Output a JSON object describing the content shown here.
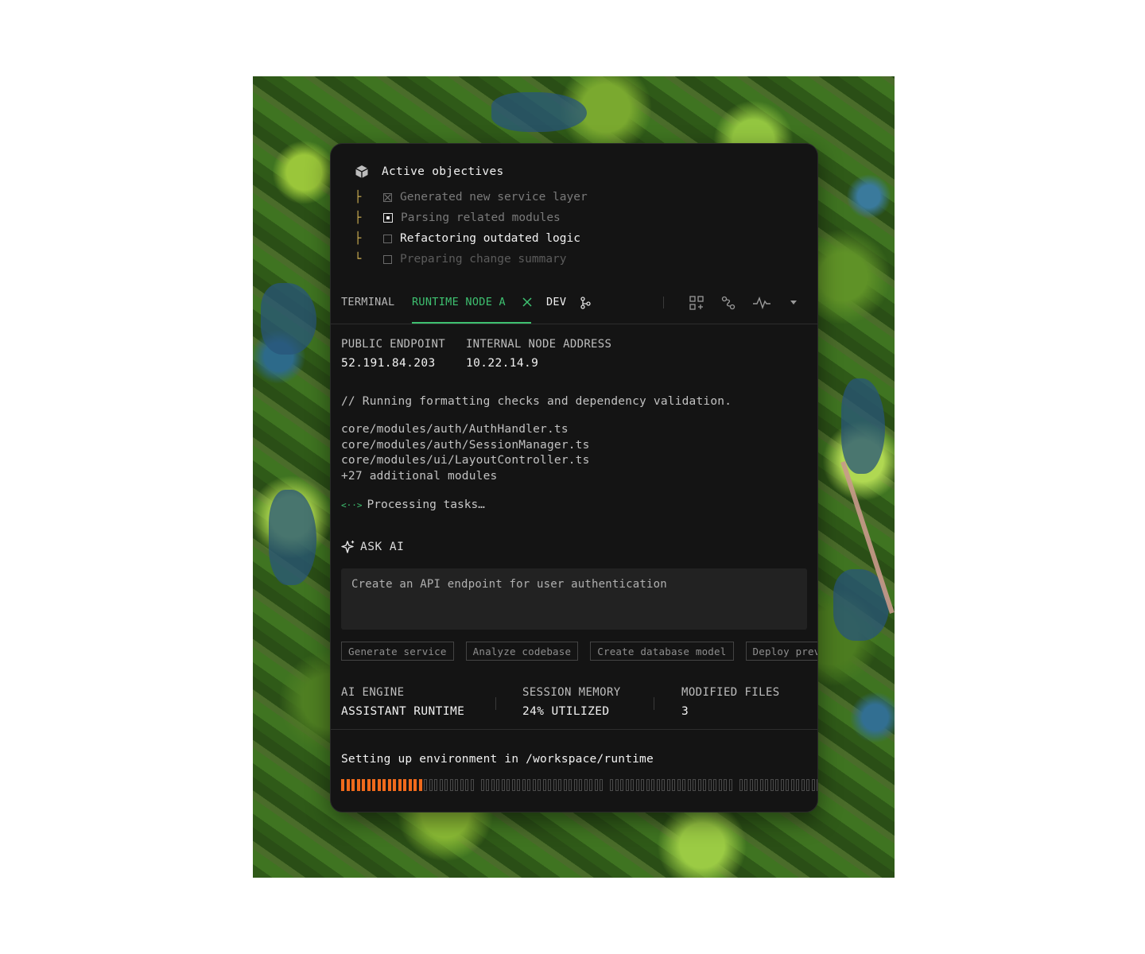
{
  "objectives": {
    "title": "Active objectives",
    "items": [
      {
        "text": "Generated new service layer",
        "status": "done",
        "branch": "├"
      },
      {
        "text": "Parsing related modules",
        "status": "active",
        "branch": "├"
      },
      {
        "text": "Refactoring outdated logic",
        "status": "current",
        "branch": "├"
      },
      {
        "text": "Preparing change summary",
        "status": "pending",
        "branch": "└"
      }
    ]
  },
  "tabs": {
    "terminal": "TERMINAL",
    "runtime": "RUNTIME NODE A",
    "dev": "DEV",
    "active_color": "#3ec070"
  },
  "toolbar_icons": [
    "grid-add-icon",
    "route-icon",
    "activity-icon",
    "chevron-down-icon"
  ],
  "endpoints": {
    "public_label": "PUBLIC ENDPOINT",
    "public_value": "52.191.84.203",
    "internal_label": "INTERNAL NODE ADDRESS",
    "internal_value": "10.22.14.9"
  },
  "log": {
    "comment": "// Running formatting checks and dependency validation.",
    "files": [
      "core/modules/auth/AuthHandler.ts",
      "core/modules/auth/SessionManager.ts",
      "core/modules/ui/LayoutController.ts",
      "+27 additional modules"
    ],
    "processing_glyph": "<··>",
    "processing": "Processing tasks…"
  },
  "ask": {
    "label": "ASK AI",
    "prompt": "Create an API endpoint for user authentication"
  },
  "suggestions": [
    "Generate service",
    "Analyze codebase",
    "Create database model",
    "Deploy preview"
  ],
  "stats": {
    "engine_label": "AI ENGINE",
    "engine_value": "ASSISTANT RUNTIME",
    "memory_label": "SESSION MEMORY",
    "memory_value": "24% UTILIZED",
    "files_label": "MODIFIED FILES",
    "files_value": "3"
  },
  "environment": {
    "text": "Setting up environment in /workspace/runtime",
    "progress_filled": 16,
    "progress_total": 90,
    "accent": "#f06a1c"
  }
}
